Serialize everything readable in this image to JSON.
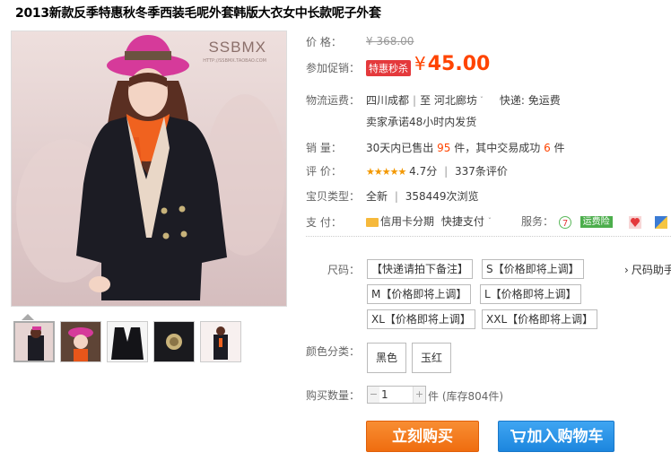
{
  "title": "2013新款反季特惠秋冬季西装毛呢外套韩版大衣女中长款呢子外套",
  "brand": {
    "logo": "SSBMX",
    "sub": "HTTP://SSBMX.TAOBAO.COM"
  },
  "price": {
    "label": "价      格：",
    "original": "¥ 368.00"
  },
  "promo": {
    "label": "参加促销：",
    "tag": "特惠秒杀",
    "currency": "¥",
    "value": "45.00"
  },
  "shipping": {
    "label": "物流运费：",
    "from": "四川成都",
    "to": "至  河北廊坊",
    "fee": "快递: 免运费",
    "promise": "卖家承诺48小时内发货"
  },
  "sales": {
    "label": "销      量：",
    "prefix": "30天内已售出",
    "count": "95",
    "mid": "件，其中交易成功",
    "success": "6",
    "suffix": "件"
  },
  "rating": {
    "label": "评      价：",
    "stars": "★★★★★",
    "score": "4.7分",
    "reviews": "337条评价"
  },
  "type": {
    "label": "宝贝类型：",
    "value": "全新",
    "views": "358449次浏览"
  },
  "pay": {
    "label": "支      付：",
    "credit": "信用卡分期",
    "fast": "快捷支付",
    "service_label": "服务：",
    "insurance": "运费险"
  },
  "size": {
    "label": "尺码：",
    "helper": "尺码助手",
    "options": [
      "【快递请拍下备注】",
      "S【价格即将上调】",
      "M【价格即将上调】",
      "L【价格即将上调】",
      "XL【价格即将上调】",
      "XXL【价格即将上调】"
    ]
  },
  "color": {
    "label": "颜色分类：",
    "options": [
      "黑色",
      "玉红"
    ]
  },
  "quantity": {
    "label": "购买数量：",
    "value": "1",
    "stock": "件 (库存804件)"
  },
  "buttons": {
    "buy": "立刻购买",
    "cart": "加入购物车"
  },
  "colors": {
    "accent": "#ff4400",
    "buy": "#f47b21",
    "cart": "#2a92e8",
    "star": "#f39800"
  }
}
